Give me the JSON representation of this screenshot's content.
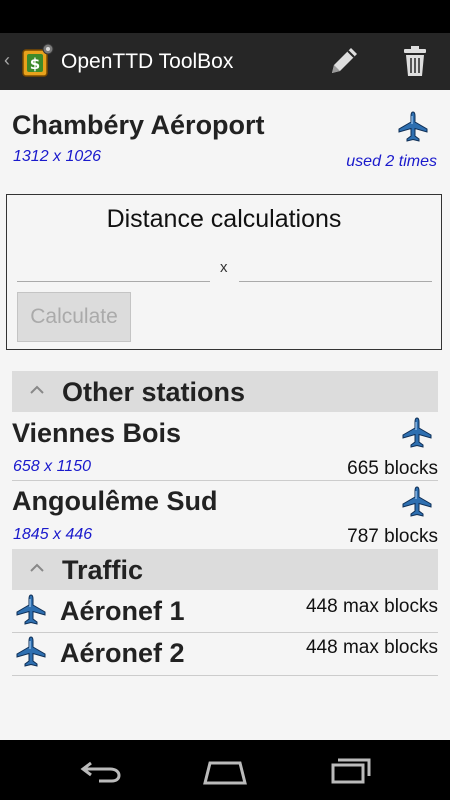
{
  "app": {
    "title": "OpenTTD ToolBox"
  },
  "station": {
    "name": "Chambéry Aéroport",
    "coords": "1312 x 1026",
    "usage": "used 2 times"
  },
  "distance": {
    "title": "Distance calculations",
    "separator": "x",
    "calculate_label": "Calculate"
  },
  "other_stations": {
    "header": "Other stations",
    "items": [
      {
        "name": "Viennes Bois",
        "coords": "658 x 1150",
        "distance": "665 blocks"
      },
      {
        "name": "Angoulême Sud",
        "coords": "1845 x 446",
        "distance": "787 blocks"
      }
    ]
  },
  "traffic": {
    "header": "Traffic",
    "items": [
      {
        "name": "Aéronef 1",
        "range": "448 max blocks"
      },
      {
        "name": "Aéronef 2",
        "range": "448 max blocks"
      }
    ]
  },
  "colors": {
    "action_bar": "#262626",
    "link_blue": "#1a1acc",
    "section_bg": "#dcdcdc",
    "plane_blue": "#2e6fb0"
  }
}
